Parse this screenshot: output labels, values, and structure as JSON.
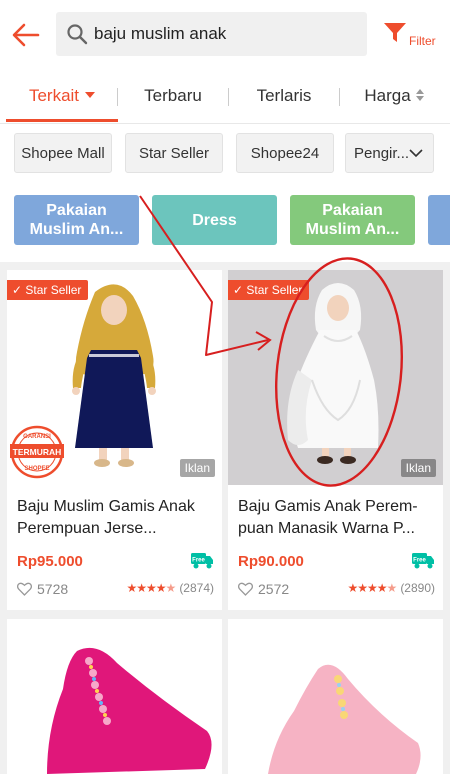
{
  "header": {
    "back_icon": "arrow-left-icon",
    "search_query": "baju muslim anak",
    "search_icon": "search-icon",
    "filter_icon": "filter-funnel-icon",
    "filter_label": "Filter",
    "accent_color": "#ee4d2d"
  },
  "tabs": [
    {
      "label": "Terkait",
      "active": true
    },
    {
      "label": "Terbaru",
      "active": false
    },
    {
      "label": "Terlaris",
      "active": false
    },
    {
      "label": "Harga",
      "active": false
    }
  ],
  "chips": [
    {
      "label": "Shopee Mall"
    },
    {
      "label": "Star Seller"
    },
    {
      "label": "Shopee24"
    },
    {
      "label": "Pengir..."
    }
  ],
  "categories": [
    {
      "label": "Pakaian Muslim An...",
      "color": "#7fa7db"
    },
    {
      "label": "Dress",
      "color": "#6cc5bd"
    },
    {
      "label": "Pakaian Muslim An...",
      "color": "#84c97c"
    },
    {
      "label": "",
      "color": "#7fa7db"
    }
  ],
  "products": [
    {
      "badge": "Star Seller",
      "stamp_text": "GARANSI TERMURAH SHOPEE",
      "ad_label": "Iklan",
      "title": "Baju Muslim Gamis Anak Perempuan Jerse...",
      "price": "Rp95.000",
      "free_shipping_label": "Free",
      "likes": "5728",
      "rating_count": "(2874)",
      "rating": 4.5
    },
    {
      "badge": "Star Seller",
      "ad_label": "Iklan",
      "title": "Baju Gamis Anak Perem-puan Manasik Warna P...",
      "price": "Rp90.000",
      "free_shipping_label": "Free",
      "likes": "2572",
      "rating_count": "(2890)",
      "rating": 4.5
    },
    {
      "image": "pink-hijab"
    },
    {
      "image": "light-pink-hijab"
    }
  ],
  "annotation": {
    "arrow_color": "#d71f1f",
    "circle_color": "#d71f1f"
  }
}
